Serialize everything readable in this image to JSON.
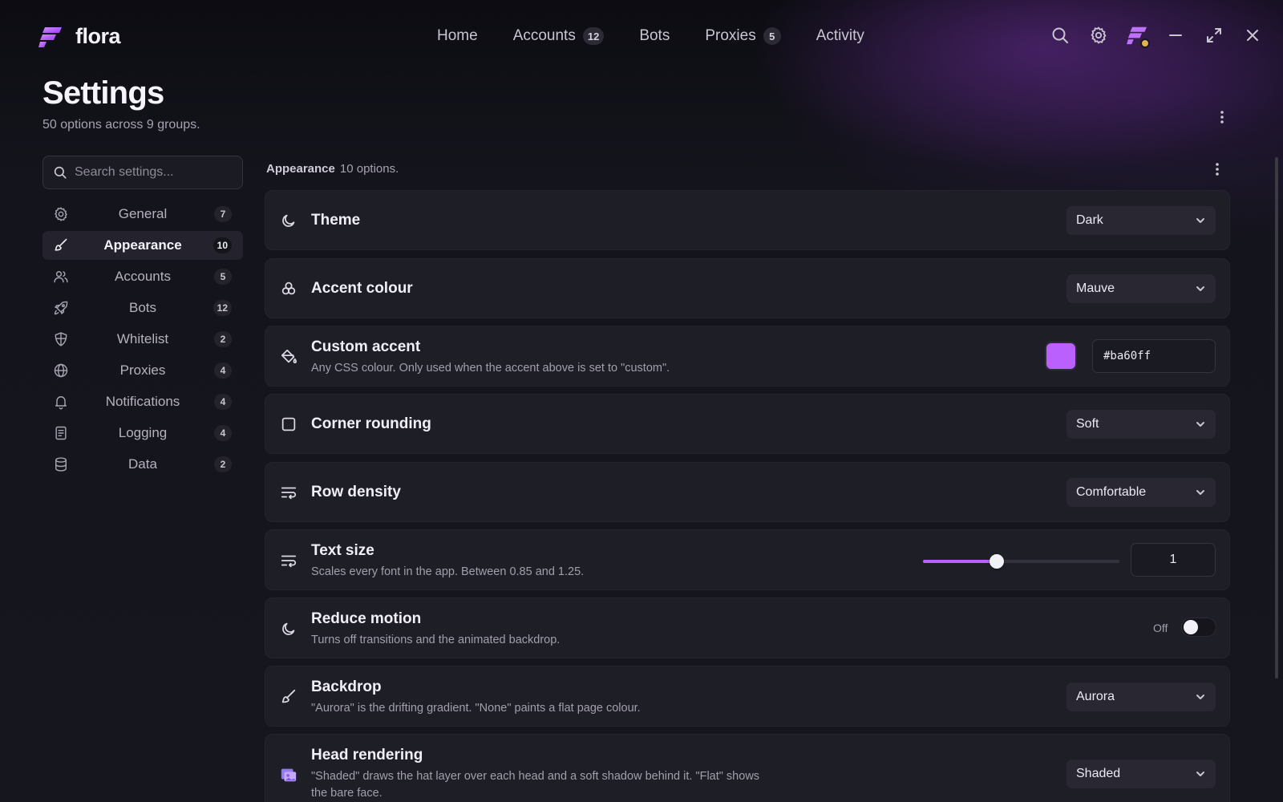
{
  "app": {
    "name": "flora"
  },
  "nav": {
    "items": [
      {
        "label": "Home",
        "badge": ""
      },
      {
        "label": "Accounts",
        "badge": "12"
      },
      {
        "label": "Bots",
        "badge": ""
      },
      {
        "label": "Proxies",
        "badge": "5"
      },
      {
        "label": "Activity",
        "badge": ""
      }
    ]
  },
  "header": {
    "title": "Settings",
    "subtitle": "50 options across 9 groups."
  },
  "sidebar": {
    "search_placeholder": "Search settings...",
    "items": [
      {
        "label": "General",
        "count": "7",
        "icon": "gear-icon"
      },
      {
        "label": "Appearance",
        "count": "10",
        "icon": "brush-icon",
        "active": true
      },
      {
        "label": "Accounts",
        "count": "5",
        "icon": "users-icon"
      },
      {
        "label": "Bots",
        "count": "12",
        "icon": "rocket-icon"
      },
      {
        "label": "Whitelist",
        "count": "2",
        "icon": "shield-icon"
      },
      {
        "label": "Proxies",
        "count": "4",
        "icon": "globe-icon"
      },
      {
        "label": "Notifications",
        "count": "4",
        "icon": "bell-icon"
      },
      {
        "label": "Logging",
        "count": "4",
        "icon": "log-icon"
      },
      {
        "label": "Data",
        "count": "2",
        "icon": "database-icon"
      }
    ]
  },
  "section": {
    "name": "Appearance",
    "count_text": "10 options."
  },
  "settings": {
    "theme": {
      "title": "Theme",
      "value": "Dark"
    },
    "accent": {
      "title": "Accent colour",
      "value": "Mauve"
    },
    "custom_accent": {
      "title": "Custom accent",
      "desc": "Any CSS colour. Only used when the accent above is set to \"custom\".",
      "value": "#ba60ff",
      "swatch_color": "#ba60ff"
    },
    "corner": {
      "title": "Corner rounding",
      "value": "Soft"
    },
    "density": {
      "title": "Row density",
      "value": "Comfortable"
    },
    "text_size": {
      "title": "Text size",
      "desc": "Scales every font in the app. Between 0.85 and 1.25.",
      "value": "1",
      "min": 0.85,
      "max": 1.25,
      "current": 1
    },
    "reduce_motion": {
      "title": "Reduce motion",
      "desc": "Turns off transitions and the animated backdrop.",
      "state_label": "Off",
      "enabled": false
    },
    "backdrop": {
      "title": "Backdrop",
      "desc": "\"Aurora\" is the drifting gradient. \"None\" paints a flat page colour.",
      "value": "Aurora"
    },
    "head_rendering": {
      "title": "Head rendering",
      "desc": "\"Shaded\" draws the hat layer over each head and a soft shadow behind it. \"Flat\" shows the bare face.",
      "value": "Shaded"
    }
  },
  "colors": {
    "accent": "#ba60ff",
    "status_dot": "#e2b24e",
    "background": "#16161e"
  }
}
